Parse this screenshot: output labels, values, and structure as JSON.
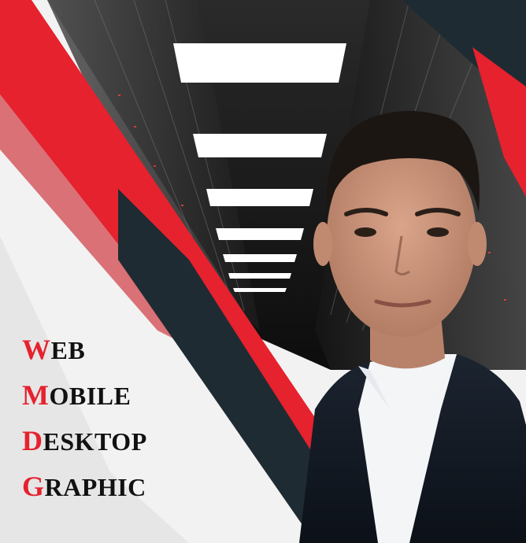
{
  "services": [
    {
      "initial": "W",
      "rest": "EB"
    },
    {
      "initial": "M",
      "rest": "OBILE"
    },
    {
      "initial": "D",
      "rest": "ESKTOP"
    },
    {
      "initial": "G",
      "rest": "RAPHIC"
    }
  ],
  "colors": {
    "accent_red": "#e5222e",
    "dark_slate": "#1f2b33",
    "text": "#111111",
    "background": "#f4f4f4"
  },
  "graphics": {
    "background": "server-corridor-photo",
    "portrait": "man-in-dark-suit-portrait"
  }
}
